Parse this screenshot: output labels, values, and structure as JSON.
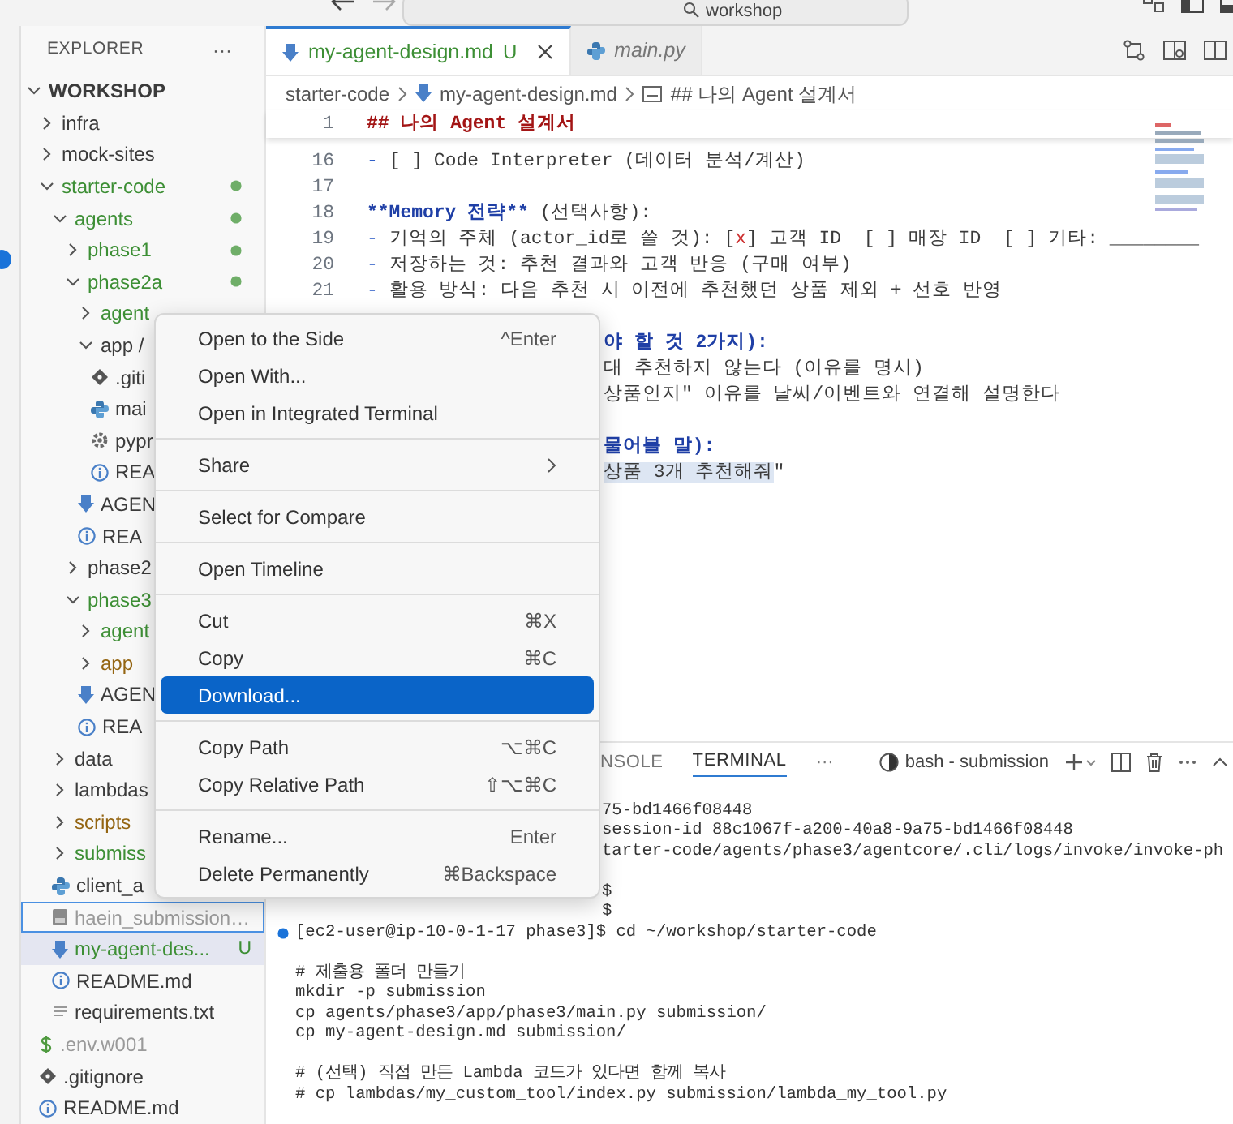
{
  "title_bar": {
    "search": "workshop"
  },
  "sidebar": {
    "title": "EXPLORER",
    "more": "···",
    "tree": [
      {
        "label": "WORKSHOP",
        "kind": "root",
        "expanded": true,
        "children": [
          {
            "label": "infra",
            "kind": "folder",
            "expanded": false
          },
          {
            "label": "mock-sites",
            "kind": "folder",
            "expanded": false
          },
          {
            "label": "starter-code",
            "kind": "folder",
            "expanded": true,
            "color": "#3d8f35",
            "dot": true,
            "children": [
              {
                "label": "agents",
                "kind": "folder",
                "expanded": true,
                "color": "#3d8f35",
                "dot": true,
                "children": [
                  {
                    "label": "phase1",
                    "kind": "folder",
                    "expanded": false,
                    "color": "#3d8f35",
                    "dot": true
                  },
                  {
                    "label": "phase2a",
                    "kind": "folder",
                    "expanded": true,
                    "color": "#3d8f35",
                    "dot": true,
                    "children": [
                      {
                        "label": "agent",
                        "kind": "folder",
                        "expanded": false,
                        "color": "#3d8f35"
                      },
                      {
                        "label": "app /",
                        "kind": "folder",
                        "expanded": true,
                        "children": [
                          {
                            "label": ".giti",
                            "kind": "git"
                          },
                          {
                            "label": "mai",
                            "kind": "python"
                          },
                          {
                            "label": "pypr",
                            "kind": "gear"
                          },
                          {
                            "label": "REA",
                            "kind": "info"
                          }
                        ]
                      },
                      {
                        "label": "AGEN",
                        "kind": "markdown"
                      },
                      {
                        "label": "REA",
                        "kind": "info"
                      }
                    ]
                  },
                  {
                    "label": "phase2",
                    "kind": "folder",
                    "expanded": false
                  },
                  {
                    "label": "phase3",
                    "kind": "folder",
                    "expanded": true,
                    "color": "#3d8f35",
                    "children": [
                      {
                        "label": "agent",
                        "kind": "folder",
                        "expanded": false,
                        "color": "#3d8f35"
                      },
                      {
                        "label": "app",
                        "kind": "folder",
                        "expanded": false,
                        "color": "#946512"
                      },
                      {
                        "label": "AGEN",
                        "kind": "markdown"
                      },
                      {
                        "label": "REA",
                        "kind": "info"
                      }
                    ]
                  }
                ]
              },
              {
                "label": "data",
                "kind": "folder",
                "expanded": false
              },
              {
                "label": "lambdas",
                "kind": "folder",
                "expanded": false
              },
              {
                "label": "scripts",
                "kind": "folder",
                "expanded": false,
                "color": "#946512"
              },
              {
                "label": "submiss",
                "kind": "folder",
                "expanded": false,
                "color": "#3d8f35"
              },
              {
                "label": "client_a",
                "kind": "python"
              },
              {
                "label": "haein_submission…",
                "kind": "file",
                "color": "#9a9a9a",
                "focused": true
              },
              {
                "label": "my-agent-des...",
                "kind": "markdown",
                "color": "#3d8f35",
                "badge": "U",
                "selected": true
              },
              {
                "label": "README.md",
                "kind": "info"
              },
              {
                "label": "requirements.txt",
                "kind": "text"
              }
            ]
          },
          {
            "label": ".env.w001",
            "kind": "dollar",
            "color": "#9a9a9a"
          },
          {
            "label": ".gitignore",
            "kind": "git"
          },
          {
            "label": "README.md",
            "kind": "info"
          }
        ]
      }
    ]
  },
  "tabs": [
    {
      "label": "my-agent-design.md",
      "badge": "U",
      "kind": "markdown",
      "selected": true,
      "preview": false
    },
    {
      "label": "main.py",
      "kind": "python",
      "selected": false,
      "preview": true
    }
  ],
  "breadcrumb": [
    "starter-code",
    "my-agent-design.md",
    "## 나의 Agent 설계서"
  ],
  "sticky_line": {
    "number": "1",
    "segments": [
      {
        "text": "## 나의 Agent 설계서",
        "kind": "heading"
      }
    ]
  },
  "editor_lines": [
    {
      "kind": "line",
      "number": "16",
      "segments": [
        {
          "text": "- ",
          "kind": "marker"
        },
        {
          "text": "[ ] Code Interpreter (데이터 분석/계산)",
          "kind": "plain"
        }
      ]
    },
    {
      "kind": "blank",
      "number": "17"
    },
    {
      "kind": "line",
      "number": "18",
      "segments": [
        {
          "text": "**Memory 전략**",
          "kind": "bold"
        },
        {
          "text": " (선택사항):",
          "kind": "plain"
        }
      ]
    },
    {
      "kind": "line",
      "number": "19",
      "segments": [
        {
          "text": "- ",
          "kind": "marker"
        },
        {
          "text": "기억의 주체 (actor_id로 쓸 것): [",
          "kind": "plain"
        },
        {
          "text": "x",
          "kind": "check"
        },
        {
          "text": "] 고객 ID  [ ] 매장 ID  [ ] 기타: ________",
          "kind": "plain"
        }
      ]
    },
    {
      "kind": "line",
      "number": "20",
      "segments": [
        {
          "text": "- ",
          "kind": "marker"
        },
        {
          "text": "저장하는 것: 추천 결과와 고객 반응 (구매 여부)",
          "kind": "plain"
        }
      ]
    },
    {
      "kind": "line",
      "number": "21",
      "segments": [
        {
          "text": "- ",
          "kind": "marker"
        },
        {
          "text": "활용 방식: 다음 추천 시 이전에 추천했던 상품 제외 + 선호 반영",
          "kind": "plain"
        }
      ]
    },
    {
      "kind": "empty"
    },
    {
      "kind": "covered",
      "segments": [
        {
          "text": "야 할 것 2가지):",
          "kind": "bold"
        }
      ]
    },
    {
      "kind": "covered",
      "segments": [
        {
          "text": "대 추천하지 않는다 (이유를 명시)",
          "kind": "plain"
        }
      ]
    },
    {
      "kind": "covered",
      "segments": [
        {
          "text": "상품인지\" 이유를 날씨/이벤트와 연결해 설명한다",
          "kind": "plain"
        }
      ]
    },
    {
      "kind": "empty"
    },
    {
      "kind": "covered",
      "segments": [
        {
          "text": "물어볼 말):",
          "kind": "bold"
        }
      ]
    },
    {
      "kind": "covered",
      "segments": [
        {
          "text": "상품 3개 추천해줘",
          "kind": "selected"
        },
        {
          "text": "\"",
          "kind": "plain"
        }
      ]
    }
  ],
  "panel": {
    "tabs": [
      {
        "label": "NSOLE",
        "selected": false
      },
      {
        "label": "TERMINAL",
        "selected": true
      }
    ],
    "more": "···",
    "terminal_name": "bash - submission"
  },
  "terminal_lines": [
    {
      "kind": "covered",
      "text": "75-bd1466f08448"
    },
    {
      "kind": "covered",
      "text": "session-id 88c1067f-a200-40a8-9a75-bd1466f08448"
    },
    {
      "kind": "covered",
      "text": "tarter-code/agents/phase3/agentcore/.cli/logs/invoke/invoke-ph"
    },
    {
      "kind": "empty"
    },
    {
      "kind": "covered",
      "text": "$"
    },
    {
      "kind": "covered",
      "text": "$"
    },
    {
      "kind": "prompt",
      "text": "[ec2-user@ip-10-0-1-17 phase3]$ cd ~/workshop/starter-code"
    },
    {
      "kind": "empty"
    },
    {
      "kind": "plain",
      "text": "# 제출용 폴더 만들기"
    },
    {
      "kind": "plain",
      "text": "mkdir -p submission"
    },
    {
      "kind": "plain",
      "text": "cp agents/phase3/app/phase3/main.py submission/"
    },
    {
      "kind": "plain",
      "text": "cp my-agent-design.md submission/"
    },
    {
      "kind": "empty"
    },
    {
      "kind": "plain",
      "text": "# (선택) 직접 만든 Lambda 코드가 있다면 함께 복사"
    },
    {
      "kind": "plain",
      "text": "# cp lambdas/my_custom_tool/index.py submission/lambda_my_tool.py"
    }
  ],
  "context_menu": [
    {
      "kind": "item",
      "label": "Open to the Side",
      "shortcut": "^Enter",
      "selected": false
    },
    {
      "kind": "item",
      "label": "Open With...",
      "selected": false
    },
    {
      "kind": "item",
      "label": "Open in Integrated Terminal",
      "selected": false
    },
    {
      "kind": "separator"
    },
    {
      "kind": "submenu",
      "label": "Share",
      "selected": false
    },
    {
      "kind": "separator"
    },
    {
      "kind": "item",
      "label": "Select for Compare",
      "selected": false
    },
    {
      "kind": "separator"
    },
    {
      "kind": "item",
      "label": "Open Timeline",
      "selected": false
    },
    {
      "kind": "separator"
    },
    {
      "kind": "item",
      "label": "Cut",
      "shortcut": "⌘X",
      "selected": false
    },
    {
      "kind": "item",
      "label": "Copy",
      "shortcut": "⌘C",
      "selected": false
    },
    {
      "kind": "item",
      "label": "Download...",
      "selected": true
    },
    {
      "kind": "separator"
    },
    {
      "kind": "item",
      "label": "Copy Path",
      "shortcut": "⌥⌘C",
      "selected": false
    },
    {
      "kind": "item",
      "label": "Copy Relative Path",
      "shortcut": "⇧⌥⌘C",
      "selected": false
    },
    {
      "kind": "separator"
    },
    {
      "kind": "item",
      "label": "Rename...",
      "shortcut": "Enter",
      "selected": false
    },
    {
      "kind": "item",
      "label": "Delete Permanently",
      "shortcut": "⌘Backspace",
      "selected": false
    }
  ]
}
